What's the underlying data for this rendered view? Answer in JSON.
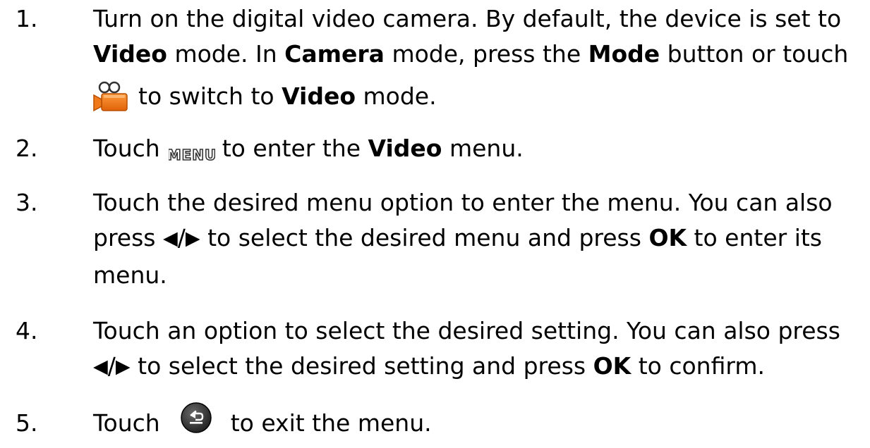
{
  "steps": [
    {
      "number": "1.",
      "t1": "Turn on the digital video camera. By default, the device is set to",
      "t2_bold": "Video",
      "t3": " mode. In ",
      "t4_bold": "Camera",
      "t5": " mode, press the ",
      "t6_bold": "Mode",
      "t7": " button or touch",
      "t8": "to switch to ",
      "t9_bold": "Video",
      "t10": " mode.",
      "icon": "video-camera-icon"
    },
    {
      "number": "2.",
      "t1": "Touch",
      "icon_text": "MENU",
      "t2": "to enter the ",
      "t3_bold": "Video",
      "t4": " menu.",
      "icon": "menu-icon"
    },
    {
      "number": "3.",
      "t1": "Touch the desired menu option to enter the menu. You can also",
      "t2": "press ",
      "arrow_left": "◀",
      "slash": "/",
      "arrow_right": "▶",
      "t3": " to select the desired menu and press ",
      "t4_bold": "OK",
      "t5": " to enter its",
      "t6": "menu."
    },
    {
      "number": "4.",
      "t1": "Touch an option to select the desired setting. You can also press",
      "arrow_left": "◀",
      "slash": "/",
      "arrow_right": "▶",
      "t2": " to select the desired setting and press ",
      "t3_bold": "OK",
      "t4": " to confirm."
    },
    {
      "number": "5.",
      "t1": "Touch",
      "t2": "to exit the menu.",
      "icon": "back-button-icon"
    }
  ],
  "colors": {
    "camera_orange": "#f07a1a",
    "camera_dark": "#c45400",
    "menu_gray": "#555555",
    "back_dark": "#2b2b2b"
  }
}
